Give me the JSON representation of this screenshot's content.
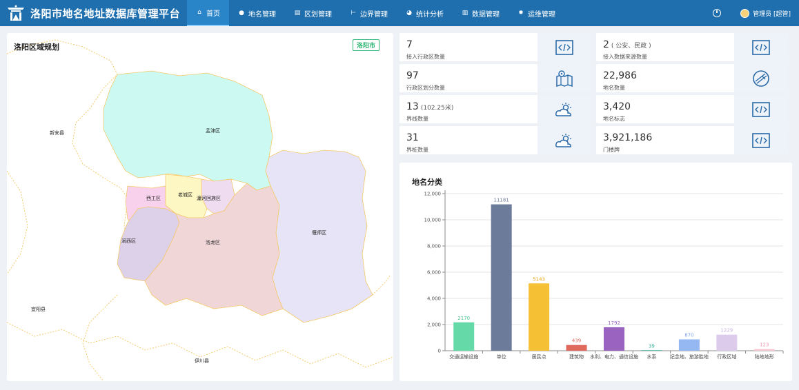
{
  "header": {
    "title": "洛阳市地名地址数据库管理平台",
    "nav": [
      {
        "label": "首页",
        "icon": "home-icon",
        "glyph": "⌂",
        "active": true
      },
      {
        "label": "地名管理",
        "icon": "location-pin-icon",
        "glyph": "●"
      },
      {
        "label": "区划管理",
        "icon": "map-icon",
        "glyph": "▤"
      },
      {
        "label": "边界管理",
        "icon": "boundary-icon",
        "glyph": "⊢"
      },
      {
        "label": "统计分析",
        "icon": "pie-chart-icon",
        "glyph": "◕"
      },
      {
        "label": "数据管理",
        "icon": "bar-chart-icon",
        "glyph": "▥"
      },
      {
        "label": "运维管理",
        "icon": "gear-icon",
        "glyph": "✹"
      }
    ],
    "user": "管理员 [超管]"
  },
  "map": {
    "title": "洛阳区域规划",
    "badge": "洛阳市",
    "labels": {
      "xinan": "新安县",
      "mengjin": "孟津区",
      "xigong": "西工区",
      "laocheng": "老城区",
      "chanhe": "瀍河回族区",
      "jianxi": "涧西区",
      "luolong": "洛龙区",
      "yanshi": "偃师区",
      "yiyang": "宜阳县",
      "yichuan": "伊川县"
    },
    "colors": {
      "mengjin": "#ccfaf2",
      "xigong": "#f8d2ec",
      "laocheng": "#fdf7c4",
      "chanhe": "#efdcf1",
      "jianxi": "#ddd0e9",
      "luolong": "#f1d6d8",
      "yanshi": "#e6e4f6",
      "border": "#f5c96a"
    }
  },
  "stats": [
    {
      "value": "7",
      "extra": "",
      "label": "接入行政区数量",
      "icon": "code-icon"
    },
    {
      "value": "2",
      "extra": "( 公安、民政 )",
      "label": "接入数据来源数量",
      "icon": "code-icon"
    },
    {
      "value": "97",
      "extra": "",
      "label": "行政区划分数量",
      "icon": "map-pin-icon"
    },
    {
      "value": "22,986",
      "extra": "",
      "label": "地名数量",
      "icon": "compass-icon"
    },
    {
      "value": "13",
      "extra": "(102.25米)",
      "label": "界线数量",
      "icon": "weather-icon"
    },
    {
      "value": "3,420",
      "extra": "",
      "label": "地名标志",
      "icon": "code-icon"
    },
    {
      "value": "31",
      "extra": "",
      "label": "界桩数量",
      "icon": "weather-icon"
    },
    {
      "value": "3,921,186",
      "extra": "",
      "label": "门楼牌",
      "icon": "code-icon"
    }
  ],
  "chart_title": "地名分类",
  "chart_data": {
    "type": "bar",
    "title": "地名分类",
    "categories": [
      "交通运输设施",
      "单位",
      "居民点",
      "建筑物",
      "水利、电力、通信设施",
      "水系",
      "纪念地、旅游胜地",
      "行政区域",
      "陆地地形"
    ],
    "values": [
      2170,
      11181,
      5143,
      439,
      1792,
      39,
      870,
      1229,
      123
    ],
    "colors": [
      "#66d9a8",
      "#6d7b9b",
      "#f5c034",
      "#e0695e",
      "#9b63c0",
      "#2fae9a",
      "#95b7f2",
      "#dccbeb",
      "#f9c6d0"
    ],
    "label_colors": [
      "#4cc38f",
      "#6d7b9b",
      "#e9a814",
      "#e0695e",
      "#9b63c0",
      "#2fae9a",
      "#7fa3e8",
      "#c7b2e0",
      "#f39bb0"
    ],
    "ylim": [
      0,
      12000
    ],
    "yticks": [
      "0",
      "2,000",
      "4,000",
      "6,000",
      "8,000",
      "10,000",
      "12,000"
    ],
    "grid": true
  }
}
